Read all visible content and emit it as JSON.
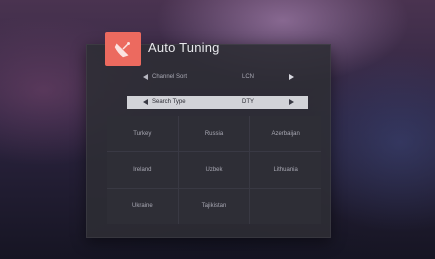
{
  "dialog": {
    "title": "Auto Tuning",
    "icon": "satellite-dish-icon",
    "accent_color": "#ec6a5f"
  },
  "settings": [
    {
      "label": "Channel Sort",
      "value": "LCN",
      "selected": false
    },
    {
      "label": "Search Type",
      "value": "DTY",
      "selected": true
    }
  ],
  "countries": [
    "Turkey",
    "Russia",
    "Azerbaijan",
    "Ireland",
    "Uzbek",
    "Lithuania",
    "Ukraine",
    "Tajikistan"
  ]
}
